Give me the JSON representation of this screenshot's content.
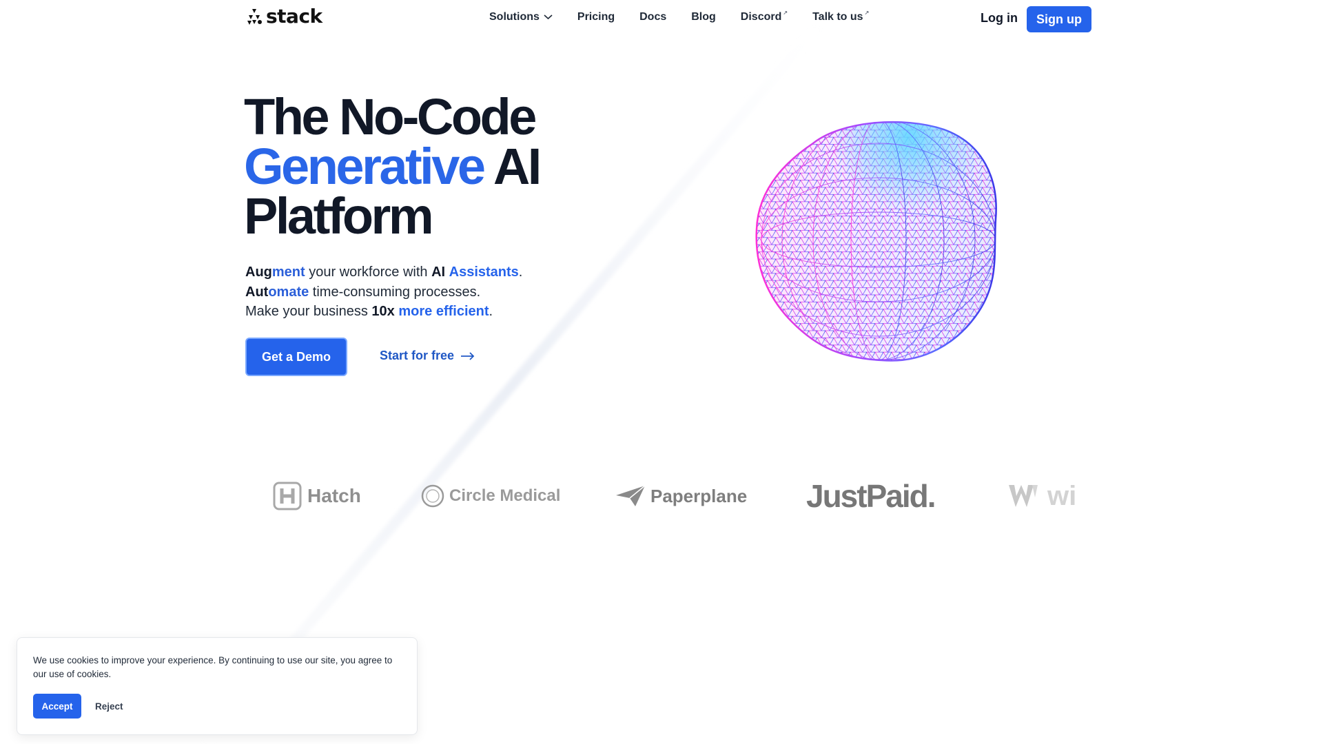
{
  "brand": {
    "name": "stack",
    "primary_color": "#2563eb",
    "text_color": "#111827"
  },
  "nav": {
    "items": [
      {
        "label": "Solutions",
        "icon": "chevron-down-icon"
      },
      {
        "label": "Pricing"
      },
      {
        "label": "Docs"
      },
      {
        "label": "Blog"
      },
      {
        "label": "Discord",
        "icon": "external-link-icon"
      },
      {
        "label": "Talk to us",
        "icon": "external-link-icon"
      }
    ],
    "login": "Log in",
    "signup": "Sign up"
  },
  "hero": {
    "title_line1": "The No-Code",
    "title_line2_blue": "Generative",
    "title_line2_rest": " AI",
    "title_line3": "Platform",
    "sub": {
      "l1_a": "Augment",
      "l1_b": " your workforce with ",
      "l1_c": "AI",
      "l1_d": "Assistants",
      "l1_e": ".",
      "l2_a": "Automate",
      "l2_b": " time-consuming processes.",
      "l3_a": "Make your business ",
      "l3_b": "10x",
      "l3_c": "more efficient",
      "l3_d": "."
    },
    "cta_primary": "Get a Demo",
    "cta_secondary": "Start for free",
    "cta_secondary_icon": "arrow-right-icon",
    "visual": "wireframe-sphere-icon"
  },
  "customer_logos": [
    {
      "name": "Hatch",
      "icon": "hatch-logo-icon"
    },
    {
      "name": "Circle Medical",
      "icon": "circle-medical-logo-icon"
    },
    {
      "name": "Paperplane",
      "icon": "paperplane-logo-icon"
    },
    {
      "name": "JustPaid.",
      "icon": "justpaid-logo-icon"
    },
    {
      "name": "wi",
      "icon": "w-logo-icon"
    }
  ],
  "cookie_banner": {
    "text": "We use cookies to improve your experience. By continuing to use our site, you agree to our use of cookies.",
    "accept": "Accept",
    "reject": "Reject"
  }
}
